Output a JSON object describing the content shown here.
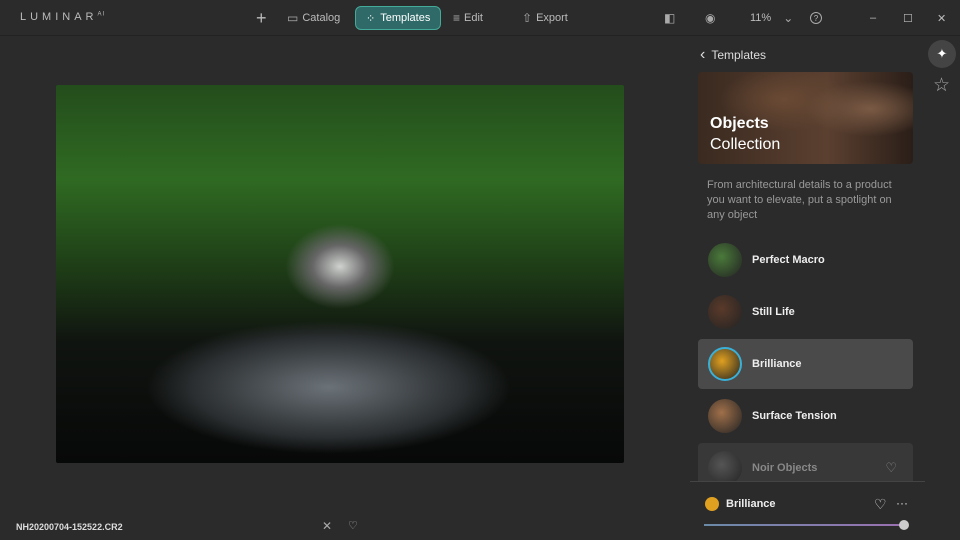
{
  "app": {
    "logo": "LUMINAR",
    "logo_sup": "AI"
  },
  "toolbar": {
    "add": "+",
    "catalog": "Catalog",
    "templates": "Templates",
    "edit": "Edit",
    "export": "Export",
    "zoom": "11%",
    "zoom_caret": "⌄",
    "help": "?"
  },
  "window": {
    "minimize": "–",
    "maximize": "☐",
    "close": "✕"
  },
  "image": {
    "filename": "NH20200704-152522.CR2"
  },
  "panel": {
    "back": "‹",
    "title": "Templates",
    "hero_title": "Objects",
    "hero_subtitle": "Collection",
    "description": "From architectural details to a product you want to elevate, put a spotlight on any object",
    "items": [
      {
        "label": "Perfect Macro",
        "color": "#4a7a3a"
      },
      {
        "label": "Still Life",
        "color": "#5a3a2a"
      },
      {
        "label": "Brilliance",
        "color": "#e0a020",
        "selected": true
      },
      {
        "label": "Surface Tension",
        "color": "#a0704a"
      },
      {
        "label": "Noir Objects",
        "color": "#555555"
      }
    ]
  },
  "applied": {
    "name": "Brilliance",
    "amount": 100,
    "more": "···"
  },
  "icons": {
    "heart": "♡",
    "star": "☆",
    "wand": "✨"
  }
}
